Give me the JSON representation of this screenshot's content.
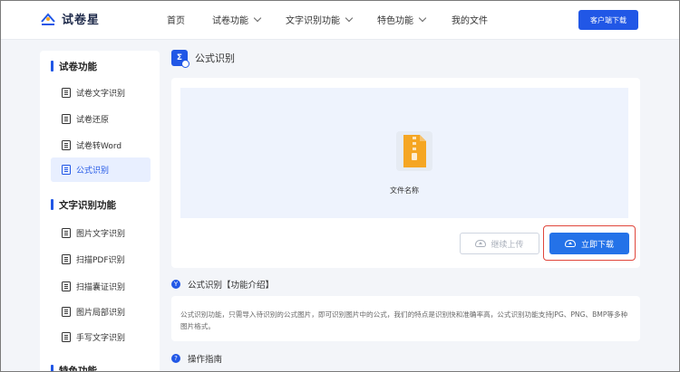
{
  "header": {
    "logo_text": "试卷星",
    "nav": [
      "首页",
      "试卷功能",
      "文字识别功能",
      "特色功能",
      "我的文件"
    ],
    "download_button": "客户端下载"
  },
  "sidebar": {
    "sections": [
      {
        "title": "试卷功能",
        "items": [
          "试卷文字识别",
          "试卷还原",
          "试卷转Word",
          "公式识别"
        ]
      },
      {
        "title": "文字识别功能",
        "items": [
          "图片文字识别",
          "扫描PDF识别",
          "扫描囊证识别",
          "图片局部识别",
          "手写文字识别"
        ]
      },
      {
        "title": "特色功能",
        "items": []
      }
    ],
    "active_item": "公式识别"
  },
  "main": {
    "title": "公式识别",
    "file_name": "文件名称",
    "continue_button": "继续上传",
    "download_button": "立即下载",
    "intro_title": "公式识别【功能介绍】",
    "intro_text": "公式识别功能，只需导入待识别的公式图片，即可识别图片中的公式，我们的特点是识别快和准确率高，公式识别功能支持JPG、PNG、BMP等多种图片格式。",
    "guide_title": "操作指南"
  },
  "colors": {
    "primary": "#2157e6",
    "download_btn": "#2472e8",
    "highlight_border": "#e0463b",
    "file_icon": "#f5a623",
    "drop_bg": "#eef3fd"
  }
}
